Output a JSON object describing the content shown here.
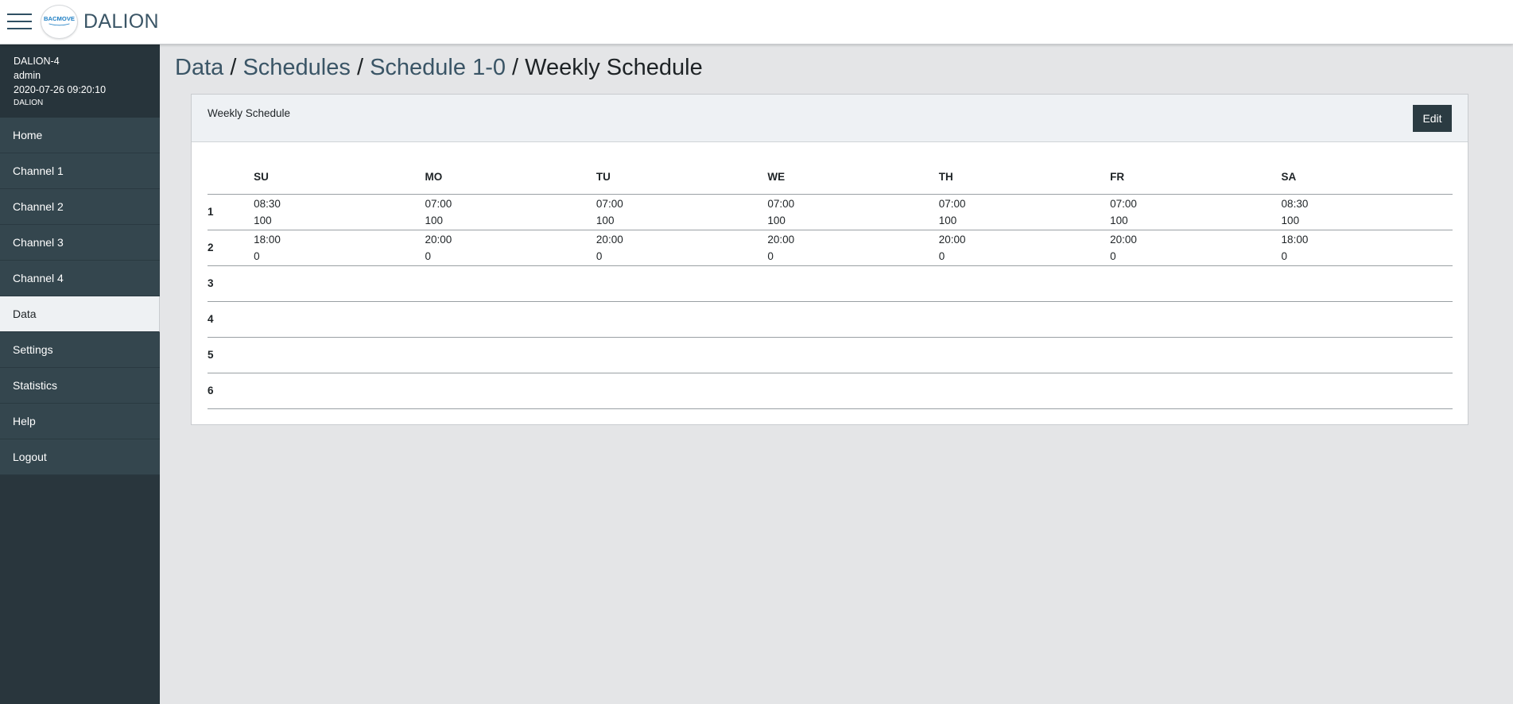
{
  "app": {
    "title": "DALION",
    "logo_text": "BACMOVE"
  },
  "device": {
    "name": "DALION-4",
    "user": "admin",
    "datetime": "2020-07-26 09:20:10",
    "model": "DALION"
  },
  "sidebar": {
    "items": [
      {
        "label": "Home",
        "active": false
      },
      {
        "label": "Channel 1",
        "active": false
      },
      {
        "label": "Channel 2",
        "active": false
      },
      {
        "label": "Channel 3",
        "active": false
      },
      {
        "label": "Channel 4",
        "active": false
      },
      {
        "label": "Data",
        "active": true
      },
      {
        "label": "Settings",
        "active": false
      },
      {
        "label": "Statistics",
        "active": false
      },
      {
        "label": "Help",
        "active": false
      },
      {
        "label": "Logout",
        "active": false
      }
    ]
  },
  "breadcrumb": {
    "items": [
      "Data",
      "Schedules",
      "Schedule 1-0"
    ],
    "separator": "/",
    "current": "Weekly Schedule"
  },
  "card": {
    "title": "Weekly Schedule",
    "edit_label": "Edit"
  },
  "schedule": {
    "days": [
      "SU",
      "MO",
      "TU",
      "WE",
      "TH",
      "FR",
      "SA"
    ],
    "rows": [
      {
        "num": "1",
        "cells": [
          {
            "time": "08:30",
            "value": "100"
          },
          {
            "time": "07:00",
            "value": "100"
          },
          {
            "time": "07:00",
            "value": "100"
          },
          {
            "time": "07:00",
            "value": "100"
          },
          {
            "time": "07:00",
            "value": "100"
          },
          {
            "time": "07:00",
            "value": "100"
          },
          {
            "time": "08:30",
            "value": "100"
          }
        ]
      },
      {
        "num": "2",
        "cells": [
          {
            "time": "18:00",
            "value": "0"
          },
          {
            "time": "20:00",
            "value": "0"
          },
          {
            "time": "20:00",
            "value": "0"
          },
          {
            "time": "20:00",
            "value": "0"
          },
          {
            "time": "20:00",
            "value": "0"
          },
          {
            "time": "20:00",
            "value": "0"
          },
          {
            "time": "18:00",
            "value": "0"
          }
        ]
      },
      {
        "num": "3",
        "cells": [
          {
            "time": "",
            "value": ""
          },
          {
            "time": "",
            "value": ""
          },
          {
            "time": "",
            "value": ""
          },
          {
            "time": "",
            "value": ""
          },
          {
            "time": "",
            "value": ""
          },
          {
            "time": "",
            "value": ""
          },
          {
            "time": "",
            "value": ""
          }
        ]
      },
      {
        "num": "4",
        "cells": [
          {
            "time": "",
            "value": ""
          },
          {
            "time": "",
            "value": ""
          },
          {
            "time": "",
            "value": ""
          },
          {
            "time": "",
            "value": ""
          },
          {
            "time": "",
            "value": ""
          },
          {
            "time": "",
            "value": ""
          },
          {
            "time": "",
            "value": ""
          }
        ]
      },
      {
        "num": "5",
        "cells": [
          {
            "time": "",
            "value": ""
          },
          {
            "time": "",
            "value": ""
          },
          {
            "time": "",
            "value": ""
          },
          {
            "time": "",
            "value": ""
          },
          {
            "time": "",
            "value": ""
          },
          {
            "time": "",
            "value": ""
          },
          {
            "time": "",
            "value": ""
          }
        ]
      },
      {
        "num": "6",
        "cells": [
          {
            "time": "",
            "value": ""
          },
          {
            "time": "",
            "value": ""
          },
          {
            "time": "",
            "value": ""
          },
          {
            "time": "",
            "value": ""
          },
          {
            "time": "",
            "value": ""
          },
          {
            "time": "",
            "value": ""
          },
          {
            "time": "",
            "value": ""
          }
        ]
      }
    ]
  },
  "icons": {
    "menu": "hamburger-menu-icon",
    "logo": "bacmove-logo-icon"
  },
  "colors": {
    "sidebar_bg": "#29363d",
    "sidebar_item_bg": "#34464e",
    "active_item_bg": "#eef1f3",
    "content_bg": "#e4e5e7",
    "breadcrumb_link": "#3a5566",
    "button_bg": "#2b3b42"
  }
}
